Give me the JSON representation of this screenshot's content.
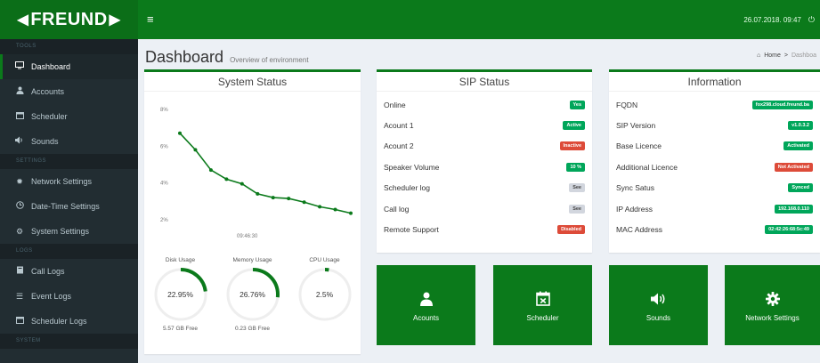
{
  "header": {
    "logo_text": "FREUND",
    "datetime": "26.07.2018. 09:47"
  },
  "sidebar": {
    "sections": [
      {
        "title": "TOOLS",
        "items": [
          {
            "label": "Dashboard",
            "icon": "monitor-icon",
            "active": true
          },
          {
            "label": "Accounts",
            "icon": "user-icon"
          },
          {
            "label": "Scheduler",
            "icon": "calendar-icon"
          },
          {
            "label": "Sounds",
            "icon": "volume-icon"
          }
        ]
      },
      {
        "title": "SETTINGS",
        "items": [
          {
            "label": "Network Settings",
            "icon": "gear-icon"
          },
          {
            "label": "Date-Time Settings",
            "icon": "clock-icon"
          },
          {
            "label": "System Settings",
            "icon": "gears-icon"
          }
        ]
      },
      {
        "title": "LOGS",
        "items": [
          {
            "label": "Call Logs",
            "icon": "book-icon"
          },
          {
            "label": "Event Logs",
            "icon": "list-icon"
          },
          {
            "label": "Scheduler Logs",
            "icon": "calendar-icon"
          }
        ]
      },
      {
        "title": "SYSTEM",
        "items": []
      }
    ]
  },
  "page": {
    "title": "Dashboard",
    "subtitle": "Overview of environment",
    "breadcrumb_home": "Home",
    "breadcrumb_current": "Dashboa"
  },
  "system_status": {
    "title": "System Status",
    "gauges": [
      {
        "label": "Disk Usage",
        "value": "22.95%",
        "fraction": 0.2295,
        "footer": "5.57 GB Free"
      },
      {
        "label": "Memory Usage",
        "value": "26.76%",
        "fraction": 0.2676,
        "footer": "0.23 GB Free"
      },
      {
        "label": "CPU Usage",
        "value": "2.5%",
        "fraction": 0.025,
        "footer": ""
      }
    ]
  },
  "chart_data": {
    "type": "line",
    "title": "",
    "y_ticks": [
      "8%",
      "6%",
      "4%",
      "2%"
    ],
    "x_ticks": [
      "09:46:30"
    ],
    "ylim": [
      2,
      8
    ],
    "x": [
      0,
      1,
      2,
      3,
      4,
      5,
      6,
      7,
      8,
      9,
      10,
      11
    ],
    "values": [
      6.9,
      6.0,
      4.9,
      4.4,
      4.15,
      3.6,
      3.4,
      3.35,
      3.15,
      2.9,
      2.75,
      2.55
    ]
  },
  "sip_status": {
    "title": "SIP Status",
    "rows": [
      {
        "label": "Online",
        "badge": "Yes",
        "color": "green"
      },
      {
        "label": "Acount 1",
        "badge": "Active",
        "color": "green"
      },
      {
        "label": "Acount 2",
        "badge": "Inactive",
        "color": "red"
      },
      {
        "label": "Speaker Volume",
        "badge": "10 %",
        "color": "green"
      },
      {
        "label": "Scheduler log",
        "badge": "See",
        "color": "grey"
      },
      {
        "label": "Call log",
        "badge": "See",
        "color": "grey"
      },
      {
        "label": "Remote Support",
        "badge": "Disabled",
        "color": "red"
      }
    ]
  },
  "information": {
    "title": "Information",
    "rows": [
      {
        "label": "FQDN",
        "badge": "fox298.cloud.freund.ba",
        "color": "green"
      },
      {
        "label": "SIP Version",
        "badge": "v1.0.3.2",
        "color": "green"
      },
      {
        "label": "Base Licence",
        "badge": "Activated",
        "color": "green"
      },
      {
        "label": "Additional Licence",
        "badge": "Not Activated",
        "color": "red"
      },
      {
        "label": "Sync Satus",
        "badge": "Synced",
        "color": "green"
      },
      {
        "label": "IP Address",
        "badge": "192.168.0.110",
        "color": "green"
      },
      {
        "label": "MAC Address",
        "badge": "02:42:26:68:5c:49",
        "color": "green"
      }
    ]
  },
  "tiles": [
    {
      "label": "Acounts",
      "icon": "user-icon"
    },
    {
      "label": "Scheduler",
      "icon": "calendar-x-icon"
    },
    {
      "label": "Sounds",
      "icon": "volume-icon"
    },
    {
      "label": "Network Settings",
      "icon": "gear-icon"
    }
  ],
  "colors": {
    "brand_green": "#0b7a1b",
    "badge_green": "#00a65a",
    "badge_red": "#dd4b39",
    "sidebar_bg": "#222d32"
  }
}
